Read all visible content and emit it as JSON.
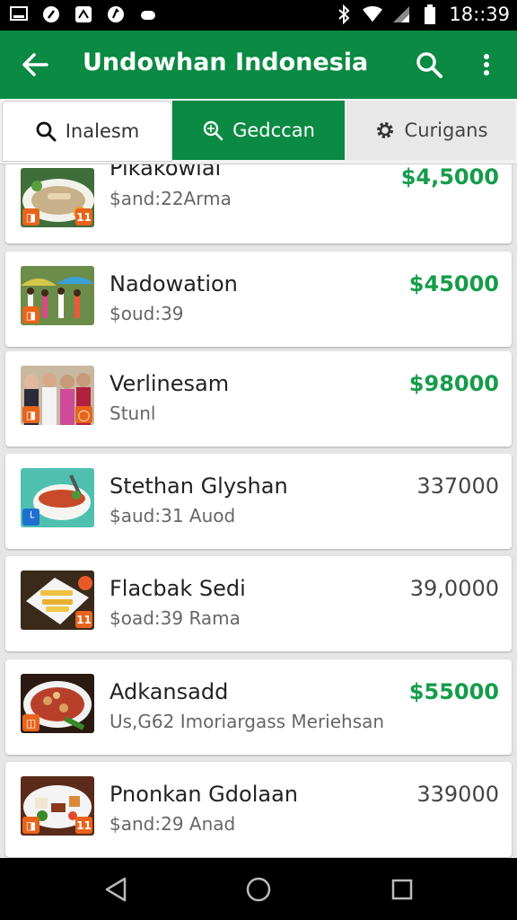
{
  "status_bar": {
    "time": "18::39",
    "left_icons": [
      "screen-icon",
      "notification-icon",
      "image-icon",
      "app-icon",
      "cloud-icon"
    ],
    "right_icons": [
      "bluetooth-icon",
      "wifi-icon",
      "signal-icon",
      "battery-icon"
    ]
  },
  "app_bar": {
    "title": "Undowhan Indonesia"
  },
  "tabs": [
    {
      "label": "Inalesm",
      "icon": "search-icon",
      "active": false
    },
    {
      "label": "Gedccan",
      "icon": "search-icon",
      "active": true
    },
    {
      "label": "Curigans",
      "icon": "gear-icon",
      "active": false
    }
  ],
  "items": [
    {
      "name": "Pikakowial",
      "sub": "$and:22Arma",
      "price": "$4,5000",
      "price_color": "#169c4a",
      "thumb": "plate"
    },
    {
      "name": "Nadowation",
      "sub": "$oud:39",
      "price": "$45000",
      "price_color": "#169c4a",
      "thumb": "market"
    },
    {
      "name": "Verlinesam",
      "sub": "Stunl",
      "price": "$98000",
      "price_color": "#169c4a",
      "thumb": "people"
    },
    {
      "name": "Stethan Glyshan",
      "sub": "$aud:31 Auod",
      "price": "337000",
      "price_color": "#444444",
      "thumb": "bowl"
    },
    {
      "name": "Flacbak Sedi",
      "sub": "$oad:39 Rama",
      "price": "39,0000",
      "price_color": "#444444",
      "thumb": "fries"
    },
    {
      "name": "Adkansadd",
      "sub": "Us,G62 Imoriargass Meriehsan",
      "price": "$55000",
      "price_color": "#169c4a",
      "thumb": "stew"
    },
    {
      "name": "Pnonkan Gdolaan",
      "sub": "$and:29 Anad",
      "price": "339000",
      "price_color": "#444444",
      "thumb": "platter"
    }
  ],
  "badges": {
    "Pikakowial": [
      "ticket",
      "ticket"
    ],
    "Nadowation": [
      "ticket"
    ],
    "Verlinesam": [
      "ticket",
      "ticket"
    ],
    "Stethan Glyshan": [
      "chart"
    ],
    "Flacbak Sedi": [
      "ticket"
    ],
    "Adkansadd": [
      "ticket"
    ],
    "Pnonkan Gdolaan": [
      "ticket",
      "ticket"
    ]
  },
  "colors": {
    "brand": "#0a8a42",
    "price_green": "#169c4a",
    "badge_orange": "#e8641b",
    "badge_blue": "#1e6fd0"
  }
}
